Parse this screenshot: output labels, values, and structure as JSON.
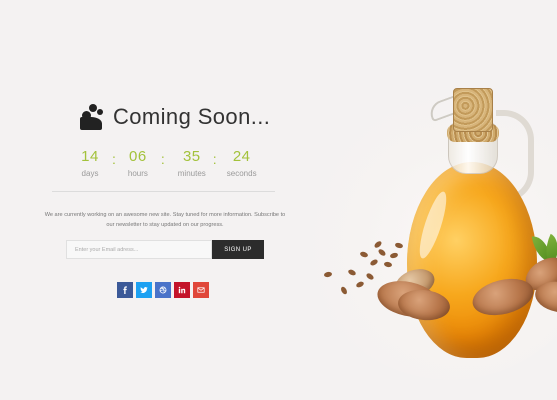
{
  "brand": {
    "title": "Coming Soon..."
  },
  "countdown": [
    {
      "value": "14",
      "label": "days"
    },
    {
      "value": "06",
      "label": "hours"
    },
    {
      "value": "35",
      "label": "minutes"
    },
    {
      "value": "24",
      "label": "seconds"
    }
  ],
  "separator": ":",
  "description": "We are currently working on an awesome new site. Stay tuned for more information. Subscribe to our newsletter to stay updated on our progress.",
  "newsletter": {
    "placeholder": "Enter your Email adress...",
    "button_label": "SIGN UP"
  },
  "social": [
    {
      "name": "facebook",
      "icon": "facebook-icon",
      "glyph": "f",
      "color": "#3b5998"
    },
    {
      "name": "twitter",
      "icon": "twitter-icon",
      "glyph": "t",
      "color": "#1da1f2"
    },
    {
      "name": "dribbble",
      "icon": "dribbble-icon",
      "glyph": "d",
      "color": "#4a73c9"
    },
    {
      "name": "linkedin",
      "icon": "linkedin-icon",
      "glyph": "in",
      "color": "#c4142a"
    },
    {
      "name": "email",
      "icon": "mail-icon",
      "glyph": "m",
      "color": "#e0473a"
    }
  ],
  "colors": {
    "accent": "#a3c23b",
    "background": "#f4f2f2",
    "button_dark": "#2c2c2c"
  }
}
